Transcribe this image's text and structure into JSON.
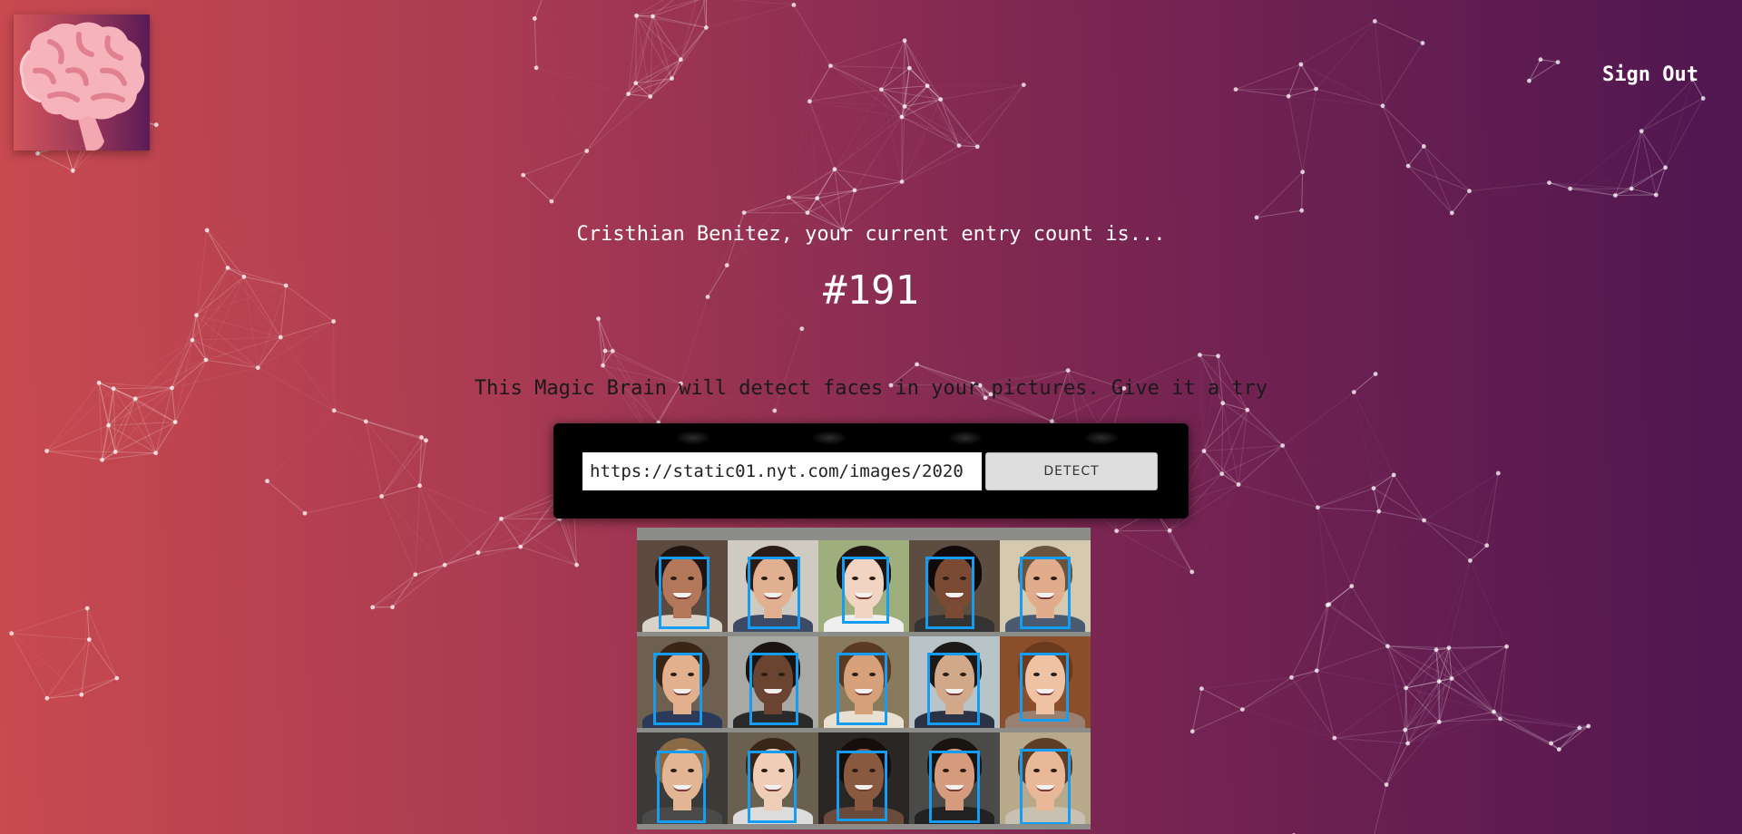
{
  "header": {
    "logo_icon": "brain-icon",
    "sign_out_label": "Sign Out"
  },
  "rank": {
    "message": "Cristhian Benitez, your current entry count is...",
    "entry_number": "#191"
  },
  "form": {
    "instructions": "This Magic Brain will detect faces in your pictures. Give it a try",
    "url_value": "https://static01.nyt.com/images/2020",
    "detect_label": "DETECT"
  },
  "result": {
    "faces_detected": 15
  },
  "colors": {
    "gradient_start": "#c94a4f",
    "gradient_end": "#4f1650",
    "bounding_box": "#149df2",
    "panel": "#000000"
  }
}
